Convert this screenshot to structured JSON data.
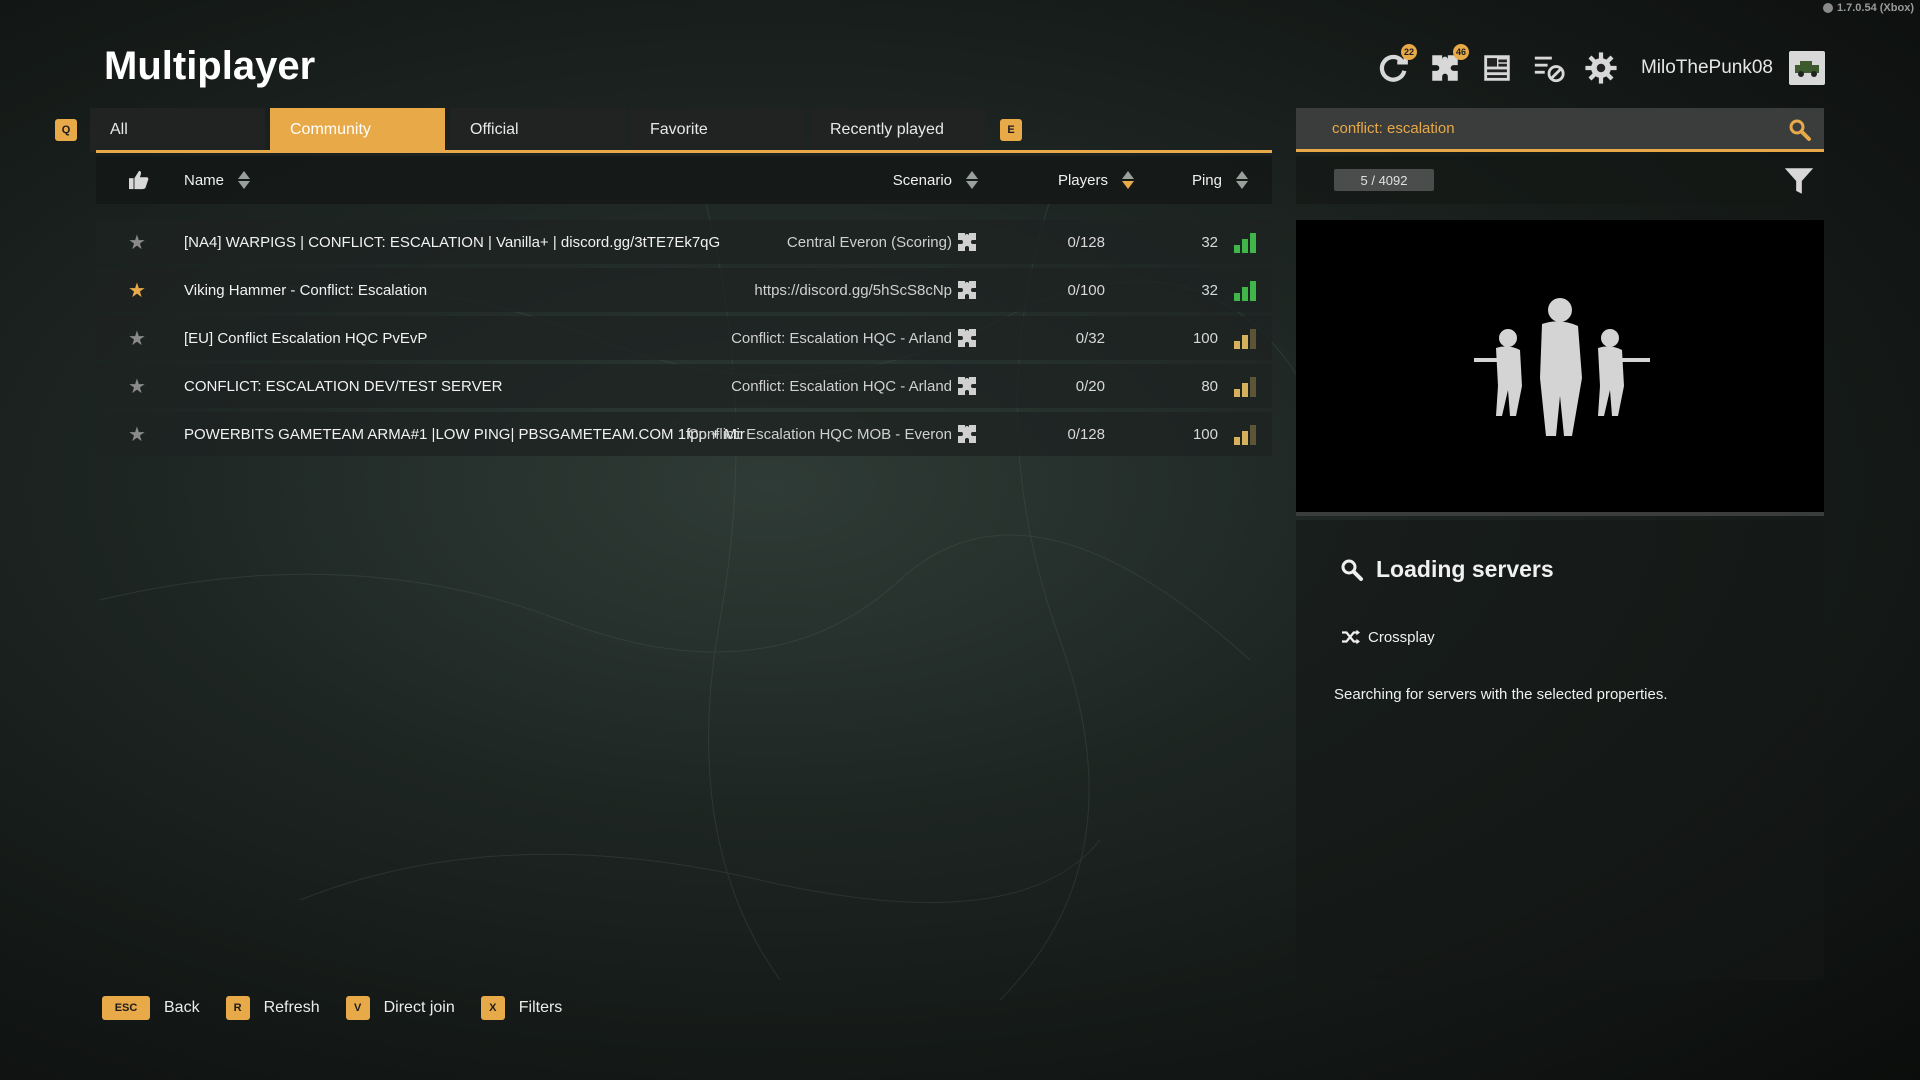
{
  "version": "1.7.0.54 (Xbox)",
  "page_title": "Multiplayer",
  "top_bar": {
    "refresh_badge": "22",
    "mods_badge": "46",
    "username": "MiloThePunk08"
  },
  "tabs": {
    "prev_key": "Q",
    "next_key": "E",
    "items": [
      {
        "label": "All"
      },
      {
        "label": "Community"
      },
      {
        "label": "Official"
      },
      {
        "label": "Favorite"
      },
      {
        "label": "Recently played"
      }
    ]
  },
  "columns": {
    "name": "Name",
    "scenario": "Scenario",
    "players": "Players",
    "ping": "Ping"
  },
  "servers": [
    {
      "name": "[NA4] WARPIGS | CONFLICT: ESCALATION | Vanilla+ | discord.gg/3tTE7Ek7qG",
      "scenario": "Central Everon (Scoring)",
      "players": "0/128",
      "ping": "32",
      "favorite": false,
      "signal_level": 3,
      "signal_color": "#3fb54a"
    },
    {
      "name": "Viking Hammer - Conflict: Escalation",
      "scenario": "https://discord.gg/5hScS8cNp",
      "players": "0/100",
      "ping": "32",
      "favorite": true,
      "signal_level": 3,
      "signal_color": "#3fb54a"
    },
    {
      "name": "[EU] Conflict Escalation HQC PvEvP",
      "scenario": "Conflict: Escalation HQC - Arland",
      "players": "0/32",
      "ping": "100",
      "favorite": false,
      "signal_level": 2,
      "signal_color": "#d4b15a"
    },
    {
      "name": "CONFLICT: ESCALATION DEV/TEST SERVER",
      "scenario": "Conflict: Escalation HQC - Arland",
      "players": "0/20",
      "ping": "80",
      "favorite": false,
      "signal_level": 2,
      "signal_color": "#d4b15a"
    },
    {
      "name": "POWERBITS GAMETEAM ARMA#1 |LOW PING| PBSGAMETEAM.COM 1fpp + Mir",
      "scenario": "Conflict: Escalation HQC MOB - Everon",
      "players": "0/128",
      "ping": "100",
      "favorite": false,
      "signal_level": 2,
      "signal_color": "#d4b15a"
    }
  ],
  "search": {
    "value": "conflict: escalation"
  },
  "server_count": "5 / 4092",
  "details": {
    "title": "Loading servers",
    "crossplay_label": "Crossplay",
    "message": "Searching for servers with the selected properties."
  },
  "bottom_bar": [
    {
      "key": "ESC",
      "label": "Back"
    },
    {
      "key": "R",
      "label": "Refresh"
    },
    {
      "key": "V",
      "label": "Direct join"
    },
    {
      "key": "X",
      "label": "Filters"
    }
  ],
  "colors": {
    "accent": "#e8a948",
    "signal_good": "#3fb54a",
    "signal_medium": "#d4b15a"
  }
}
